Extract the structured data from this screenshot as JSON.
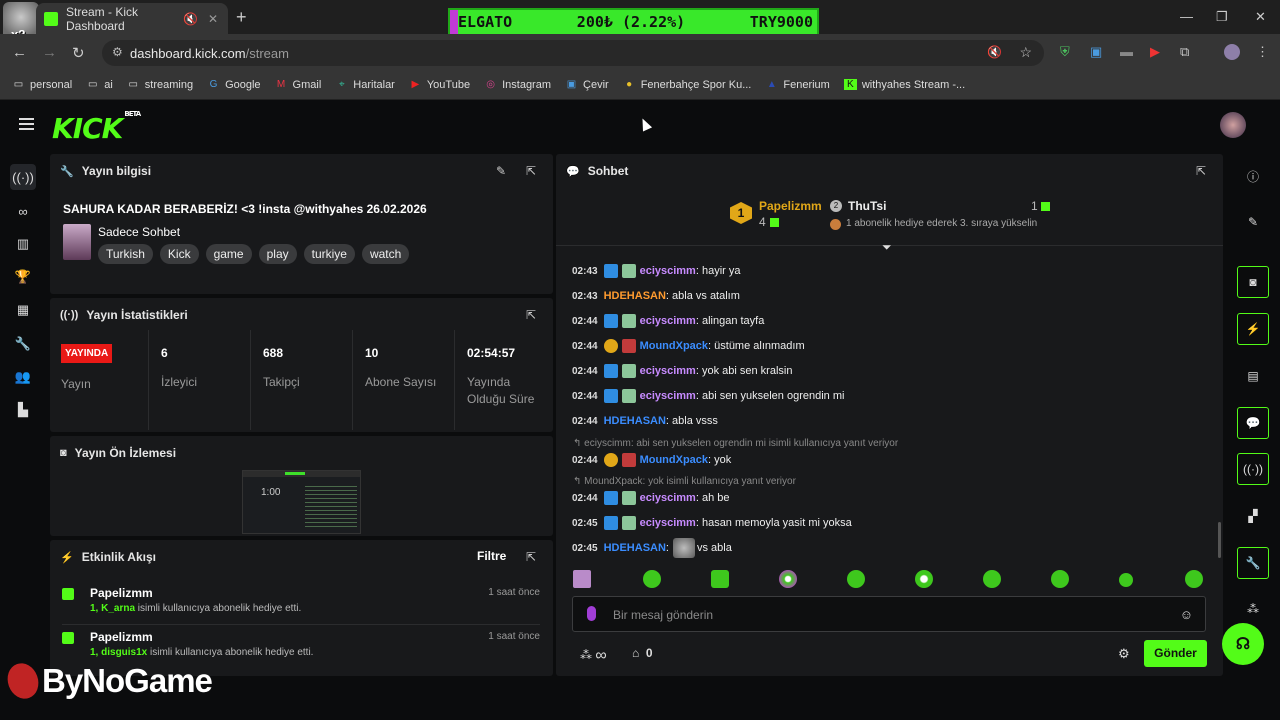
{
  "browser": {
    "tab_title": "Stream - Kick Dashboard",
    "url_host": "dashboard.kick.com",
    "url_path": "/stream",
    "overlay_badge": "x2",
    "bookmarks": [
      "personal",
      "ai",
      "streaming",
      "Google",
      "Gmail",
      "Haritalar",
      "YouTube",
      "Instagram",
      "Çevir",
      "Fenerbahçe Spor Ku...",
      "Fenerium",
      "withyahes Stream -..."
    ]
  },
  "ticker": {
    "symbol": "ELGATO",
    "price": "200₺ (2.22%)",
    "goal": "TRY9000"
  },
  "accent": "#53fc18",
  "logo": {
    "text": "KICK",
    "beta": "BETA"
  },
  "stream_info": {
    "header": "Yayın bilgisi",
    "title": "SAHURA KADAR BERABERİZ! <3 !insta @withyahes 26.02.2026",
    "category": "Sadece Sohbet",
    "tags": [
      "Turkish",
      "Kick",
      "game",
      "play",
      "turkiye",
      "watch"
    ]
  },
  "stats": {
    "header": "Yayın İstatistikleri",
    "live_badge": "YAYINDA",
    "live_label": "Yayın",
    "viewers": "6",
    "viewers_label": "İzleyici",
    "followers": "688",
    "followers_label": "Takipçi",
    "subs": "10",
    "subs_label": "Abone Sayısı",
    "uptime": "02:54:57",
    "uptime_label": "Yayında Olduğu Süre"
  },
  "preview": {
    "header": "Yayın Ön İzlemesi",
    "clock": "1:00"
  },
  "activity": {
    "header": "Etkinlik Akışı",
    "filter": "Filtre",
    "events": [
      {
        "name": "Papelizmm",
        "time": "1 saat önce",
        "highlight": "1, K_arna",
        "rest": " isimli kullanıcıya abonelik hediye etti."
      },
      {
        "name": "Papelizmm",
        "time": "1 saat önce",
        "highlight": "1, disguis1x",
        "rest": " isimli kullanıcıya abonelik hediye etti."
      }
    ]
  },
  "chat": {
    "header": "Sohbet",
    "leader1": {
      "rank": "1",
      "name": "Papelizmm",
      "count": "4"
    },
    "leader2": {
      "rank": "2",
      "name": "ThuTsi",
      "count": "1",
      "note": "1 abonelik hediye ederek 3. sıraya yükselin"
    },
    "messages": [
      {
        "time": "02:43",
        "user": "eciyscimm",
        "color": "#c78bff",
        "text": ": hayir ya"
      },
      {
        "time": "02:43",
        "user": "HDEHASAN",
        "color": "#ff9b2f",
        "text": ": abla vs atalım"
      },
      {
        "time": "02:44",
        "user": "eciyscimm",
        "color": "#c78bff",
        "text": ": alingan tayfa"
      },
      {
        "time": "02:44",
        "user": "MoundXpack",
        "color": "#3b8dff",
        "text": ": üstüme alınmadım"
      },
      {
        "time": "02:44",
        "user": "eciyscimm",
        "color": "#c78bff",
        "text": ": yok abi sen kralsin"
      },
      {
        "time": "02:44",
        "user": "eciyscimm",
        "color": "#c78bff",
        "text": ": abi sen yukselen ogrendin mi"
      },
      {
        "time": "02:44",
        "user": "HDEHASAN",
        "color": "#3b8dff",
        "text": ": abla vsss"
      },
      {
        "time": "02:44",
        "user": "MoundXpack",
        "color": "#3b8dff",
        "text": ": yok"
      },
      {
        "time": "02:44",
        "user": "eciyscimm",
        "color": "#c78bff",
        "text": ": ah be"
      },
      {
        "time": "02:45",
        "user": "eciyscimm",
        "color": "#c78bff",
        "text": ": hasan memoyla yasit mi yoksa"
      },
      {
        "time": "02:45",
        "user": "HDEHASAN",
        "color": "#3b8dff",
        "text": "vs abla"
      }
    ],
    "replies": [
      "eciyscimm: abi sen yukselen ogrendin mi isimli kullanıcıya yanıt veriyor",
      "MoundXpack: yok isimli kullanıcıya yanıt veriyor"
    ],
    "input_placeholder": "Bir mesaj gönderin",
    "points": "∞",
    "store_count": "0",
    "send": "Gönder"
  },
  "watermark": "ByNoGame"
}
